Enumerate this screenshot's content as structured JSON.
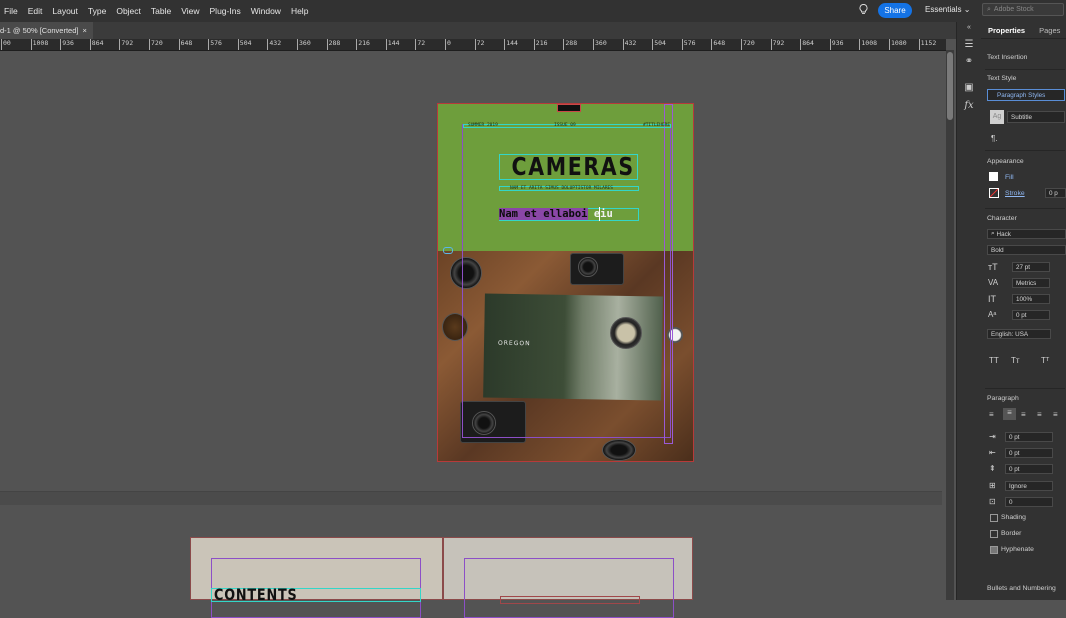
{
  "menu": [
    "File",
    "Edit",
    "Layout",
    "Type",
    "Object",
    "Table",
    "View",
    "Plug-Ins",
    "Window",
    "Help"
  ],
  "header": {
    "share_label": "Share",
    "workspace": "Essentials",
    "stock_placeholder": "Adobe Stock"
  },
  "doc_tab": "d-1 @ 50% [Converted]",
  "ruler_labels": [
    "00",
    "1008",
    "936",
    "864",
    "792",
    "720",
    "648",
    "576",
    "504",
    "432",
    "360",
    "288",
    "216",
    "144",
    "72",
    "0",
    "72",
    "144",
    "216",
    "288",
    "360",
    "432",
    "504",
    "576",
    "648",
    "720",
    "792",
    "864",
    "936",
    "1008",
    "1080",
    "1152"
  ],
  "document": {
    "top_line_left": "SUMMER 2019",
    "top_line_mid": "ISSUE 09",
    "top_line_right": "#TITLEHERE",
    "title": "CAMERAS",
    "tagline": "NAM ET ARITA SIMUS DOLUPTISTOR MILARES",
    "subtitle_selected": "Nam et ellaboi",
    "subtitle_rest": " eiu",
    "magazine_word": "OREGON",
    "spread_heading": "CONTENTS"
  },
  "panel": {
    "tabs": [
      "Properties",
      "Pages"
    ],
    "section_text_insertion": "Text Insertion",
    "section_text_style": "Text Style",
    "paragraph_styles": "Paragraph Styles",
    "style_name": "Subtitle",
    "style_swatch": "Ag",
    "section_appearance": "Appearance",
    "fill_label": "Fill",
    "stroke_label": "Stroke",
    "stroke_value": "0 p",
    "section_character": "Character",
    "font_family": "Hack",
    "font_style": "Bold",
    "font_size": "27 pt",
    "kerning": "Metrics",
    "h_scale": "100%",
    "baseline": "0 pt",
    "language": "English: USA",
    "section_paragraph": "Paragraph",
    "left_indent": "0 pt",
    "first_line_indent": "0 pt",
    "space_before": "0 pt",
    "align_to_grid": "Ignore",
    "drop_cap": "0",
    "shading_label": "Shading",
    "border_label": "Border",
    "hyphenate_label": "Hyphenate",
    "bullets_label": "Bullets and Numbering"
  }
}
